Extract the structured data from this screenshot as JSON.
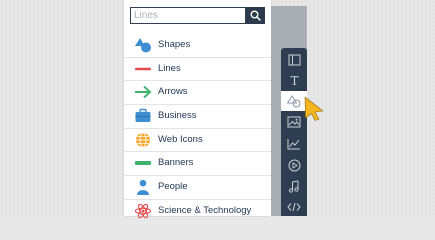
{
  "search": {
    "placeholder": "Lines",
    "icon": "search-icon"
  },
  "categories": [
    {
      "label": "Shapes",
      "icon": "shapes-icon",
      "color": "#3d8fd1"
    },
    {
      "label": "Lines",
      "icon": "line-icon",
      "color": "#e24c4c"
    },
    {
      "label": "Arrows",
      "icon": "arrow-right-icon",
      "color": "#3fb36d"
    },
    {
      "label": "Business",
      "icon": "briefcase-icon",
      "color": "#3d8fd1"
    },
    {
      "label": "Web Icons",
      "icon": "globe-icon",
      "color": "#f3a626"
    },
    {
      "label": "Banners",
      "icon": "banner-icon",
      "color": "#3fb36d"
    },
    {
      "label": "People",
      "icon": "person-icon",
      "color": "#3d8fd1"
    },
    {
      "label": "Science & Technology",
      "icon": "atom-icon",
      "color": "#e24c4c"
    }
  ],
  "toolbar": {
    "items": [
      {
        "icon": "layout-icon"
      },
      {
        "icon": "text-icon"
      },
      {
        "icon": "shapes-icon",
        "active": true
      },
      {
        "icon": "image-icon"
      },
      {
        "icon": "chart-icon"
      },
      {
        "icon": "play-icon"
      },
      {
        "icon": "music-icon"
      },
      {
        "icon": "code-icon"
      }
    ],
    "active_index": 2
  },
  "colors": {
    "navy": "#2f3d50",
    "rail": "#a9aeb4",
    "cursor": "#f5b51f",
    "label": "#1f3552"
  }
}
